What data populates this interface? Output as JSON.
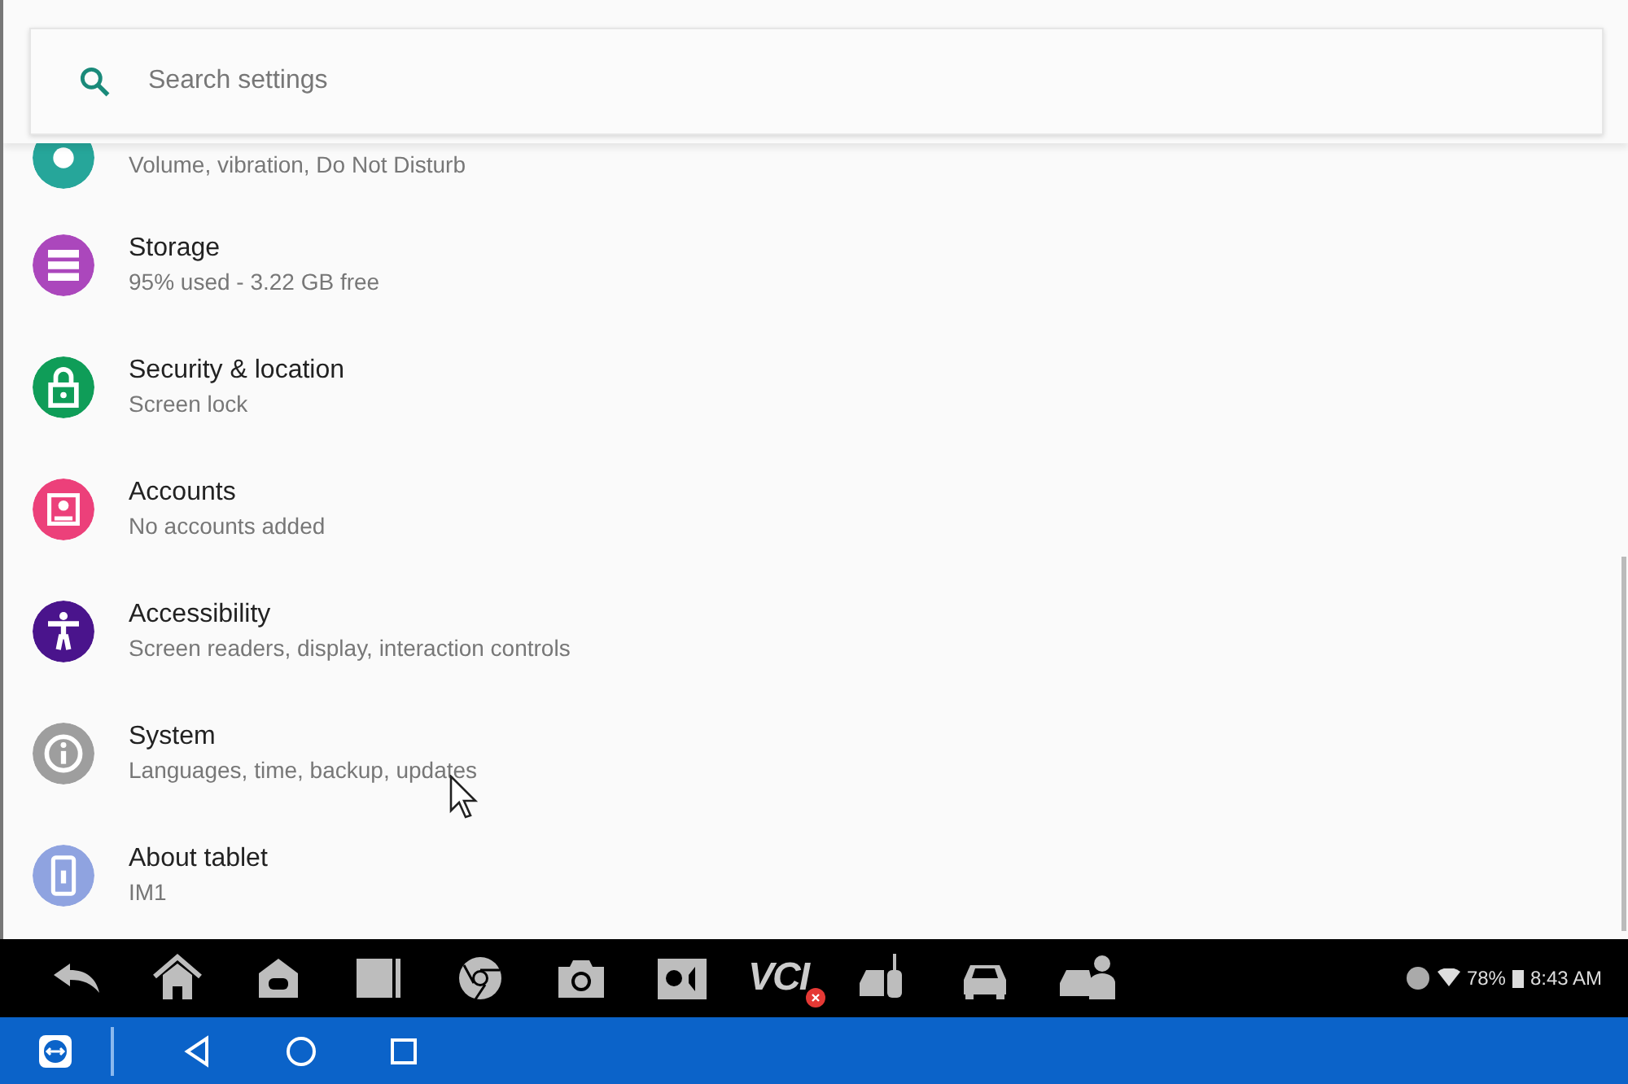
{
  "search": {
    "placeholder": "Search settings"
  },
  "settings": [
    {
      "kind": "partial",
      "subtitle": "Volume, vibration, Do Not Disturb",
      "color": "#26a69a"
    },
    {
      "kind": "item",
      "title": "Storage",
      "subtitle": "95% used - 3.22 GB free",
      "color": "#ab47bc"
    },
    {
      "kind": "item",
      "title": "Security & location",
      "subtitle": "Screen lock",
      "color": "#0f9d58"
    },
    {
      "kind": "item",
      "title": "Accounts",
      "subtitle": "No accounts added",
      "color": "#ec407a"
    },
    {
      "kind": "item",
      "title": "Accessibility",
      "subtitle": "Screen readers, display, interaction controls",
      "color": "#4a148c"
    },
    {
      "kind": "item",
      "title": "System",
      "subtitle": "Languages, time, backup, updates",
      "color": "#9e9e9e"
    },
    {
      "kind": "item",
      "title": "About tablet",
      "subtitle": "IM1",
      "color": "#8fa3e0"
    }
  ],
  "taskbar": [
    {
      "kind": "icon"
    },
    {
      "kind": "icon"
    },
    {
      "kind": "icon"
    },
    {
      "kind": "icon"
    },
    {
      "kind": "icon"
    },
    {
      "kind": "icon"
    },
    {
      "kind": "icon"
    },
    {
      "kind": "text",
      "label": "VCI"
    },
    {
      "kind": "icon"
    },
    {
      "kind": "icon"
    },
    {
      "kind": "icon"
    }
  ],
  "status": {
    "battery": "78%",
    "time": "8:43 AM"
  }
}
